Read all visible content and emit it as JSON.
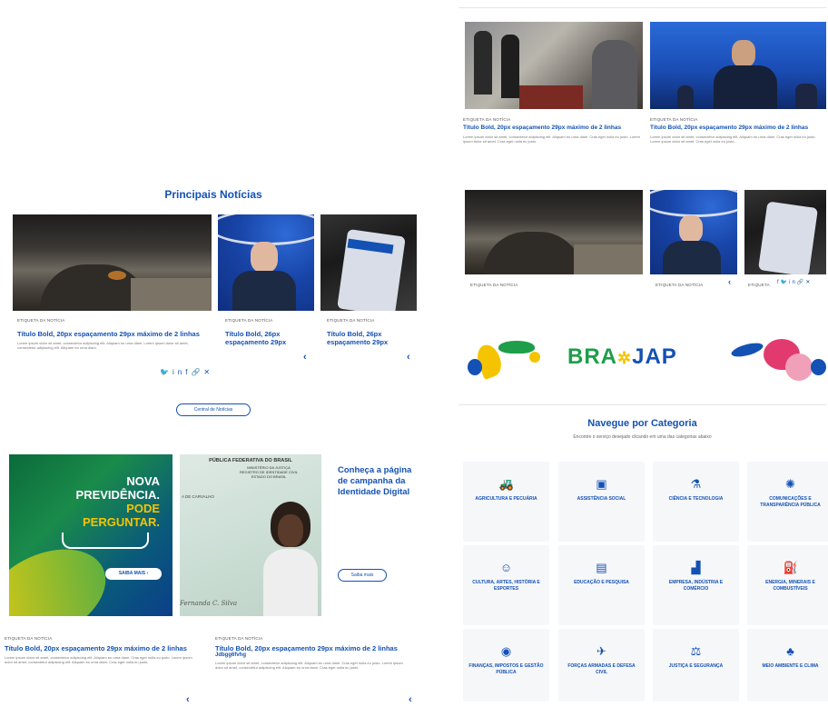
{
  "left": {
    "section_title": "Principais Notícias",
    "news": [
      {
        "tag": "ETIQUETA DA NOTÍCIA",
        "title": "Título Bold, 20px espaçamento 29px máximo de 2 linhas",
        "body": "Lorem ipsum dolor sit amet, consectetur adipiscing elit. Aliquam eu urna diam. Lorem ipsum dolor sit amet, consectetur adipiscing elit. Aliquam eu urna diam."
      },
      {
        "tag": "ETIQUETA DA NOTÍCIA",
        "title": "Título Bold, 26px espaçamento 29px"
      },
      {
        "tag": "ETIQUETA DA NOTÍCIA",
        "title": "Título Bold, 26px espaçamento 29px"
      }
    ],
    "share_icons": [
      "twitter-icon",
      "linkedin-icon",
      "facebook-icon",
      "link-icon",
      "close-icon"
    ],
    "central_button": "Central de Notícias",
    "banner": {
      "line1": "NOVA",
      "line2": "PREVIDÊNCIA.",
      "line3": "PODE",
      "line4": "PERGUNTAR.",
      "cta": "SAIBA MAIS ›"
    },
    "id_card": {
      "h1": "PÚBLICA FEDERATIVA DO BRASIL",
      "h2": "MINISTÉRIO DA JUSTIÇA",
      "h3": "REGISTRO DE IDENTIDADE CIVIL",
      "h4": "ESTADO DO BRASIL",
      "field1": "A DE CARVALHO",
      "signature": "Fernanda C. Silva"
    },
    "campaign": {
      "text": "Conheça a página de campanha da Identidade Digital",
      "button": "Saiba mais"
    },
    "bottom_news": [
      {
        "tag": "ETIQUETA DA NOTÍCIA",
        "title": "Título Bold, 20px espaçamento 29px máximo de 2 linhas",
        "body": "Lorem ipsum dolor sit amet, consectetur adipiscing elit. Aliquam eu urna diam. Cras eget nulla eu justo. Lorem ipsum dolor sit amet, consectetur adipiscing elit. Aliquam eu urna diam. Cras eget nulla eu justo."
      },
      {
        "tag": "ETIQUETA DA NOTÍCIA",
        "title": "Título Bold, 20px espaçamento 29px máximo de 2 linhas",
        "extra": "Jdbgg6fvhg",
        "body": "Lorem ipsum dolor sit amet, consectetur adipiscing elit. Aliquam eu urna diam. Cras eget nulla eu justo. Lorem ipsum dolor sit amet, consectetur adipiscing elit. Aliquam eu urna diam. Cras eget nulla eu justo."
      }
    ]
  },
  "right": {
    "top_news": [
      {
        "tag": "ETIQUETA DA NOTÍCIA",
        "title": "Título Bold, 20px espaçamento 29px máximo de 2 linhas",
        "body": "Lorem ipsum dolor sit amet, consectetur adipiscing elit. Aliquam eu urna diam. Cras eget nulla eu justo. Lorem ipsum dolor sit amet. Cras eget nulla eu justo."
      },
      {
        "tag": "ETIQUETA DA NOTÍCIA",
        "title": "Título Bold, 20px espaçamento 29px máximo de 2 linhas",
        "body": "Lorem ipsum dolor sit amet, consectetur adipiscing elit. Aliquam eu urna diam. Cras eget nulla eu justo. Lorem ipsum dolor sit amet. Cras eget nulla eu justo."
      }
    ],
    "strip_tags": [
      "ETIQUETA DA NOTÍCIA",
      "ETIQUETA DA NOTÍCIA",
      "ETIQUETA"
    ],
    "braz_jap": {
      "left": "BRA",
      "mid": "✲",
      "right": "JAP"
    },
    "nav_title": "Navegue por Categoria",
    "nav_sub": "Encontre o serviço desejado clicando em uma das categorias abaixo",
    "categories": [
      {
        "label": "AGRICULTURA E PECUÁRIA",
        "icon": "tractor-icon",
        "glyph": "🚜"
      },
      {
        "label": "ASSISTÊNCIA SOCIAL",
        "icon": "id-card-icon",
        "glyph": "▣"
      },
      {
        "label": "CIÊNCIA E TECNOLOGIA",
        "icon": "microscope-icon",
        "glyph": "⚗"
      },
      {
        "label": "COMUNICAÇÕES E TRANSPARÊNCIA PÚBLICA",
        "icon": "satellite-icon",
        "glyph": "✺"
      },
      {
        "label": "CULTURA, ARTES, HISTÓRIA E ESPORTES",
        "icon": "theater-masks-icon",
        "glyph": "☺"
      },
      {
        "label": "EDUCAÇÃO E PESQUISA",
        "icon": "book-icon",
        "glyph": "▤"
      },
      {
        "label": "EMPRESA, INDÚSTRIA E COMÉRCIO",
        "icon": "industry-icon",
        "glyph": "▟"
      },
      {
        "label": "ENERGIA, MINERAIS E COMBUSTÍVEIS",
        "icon": "gas-pump-icon",
        "glyph": "⛽"
      },
      {
        "label": "FINANÇAS, IMPOSTOS E GESTÃO PÚBLICA",
        "icon": "coins-icon",
        "glyph": "◉"
      },
      {
        "label": "FORÇAS ARMADAS E DEFESA CIVIL",
        "icon": "plane-icon",
        "glyph": "✈"
      },
      {
        "label": "JUSTIÇA E SEGURANÇA",
        "icon": "balance-scale-icon",
        "glyph": "⚖"
      },
      {
        "label": "MEIO AMBIENTE E CLIMA",
        "icon": "tree-icon",
        "glyph": "♣"
      }
    ]
  }
}
